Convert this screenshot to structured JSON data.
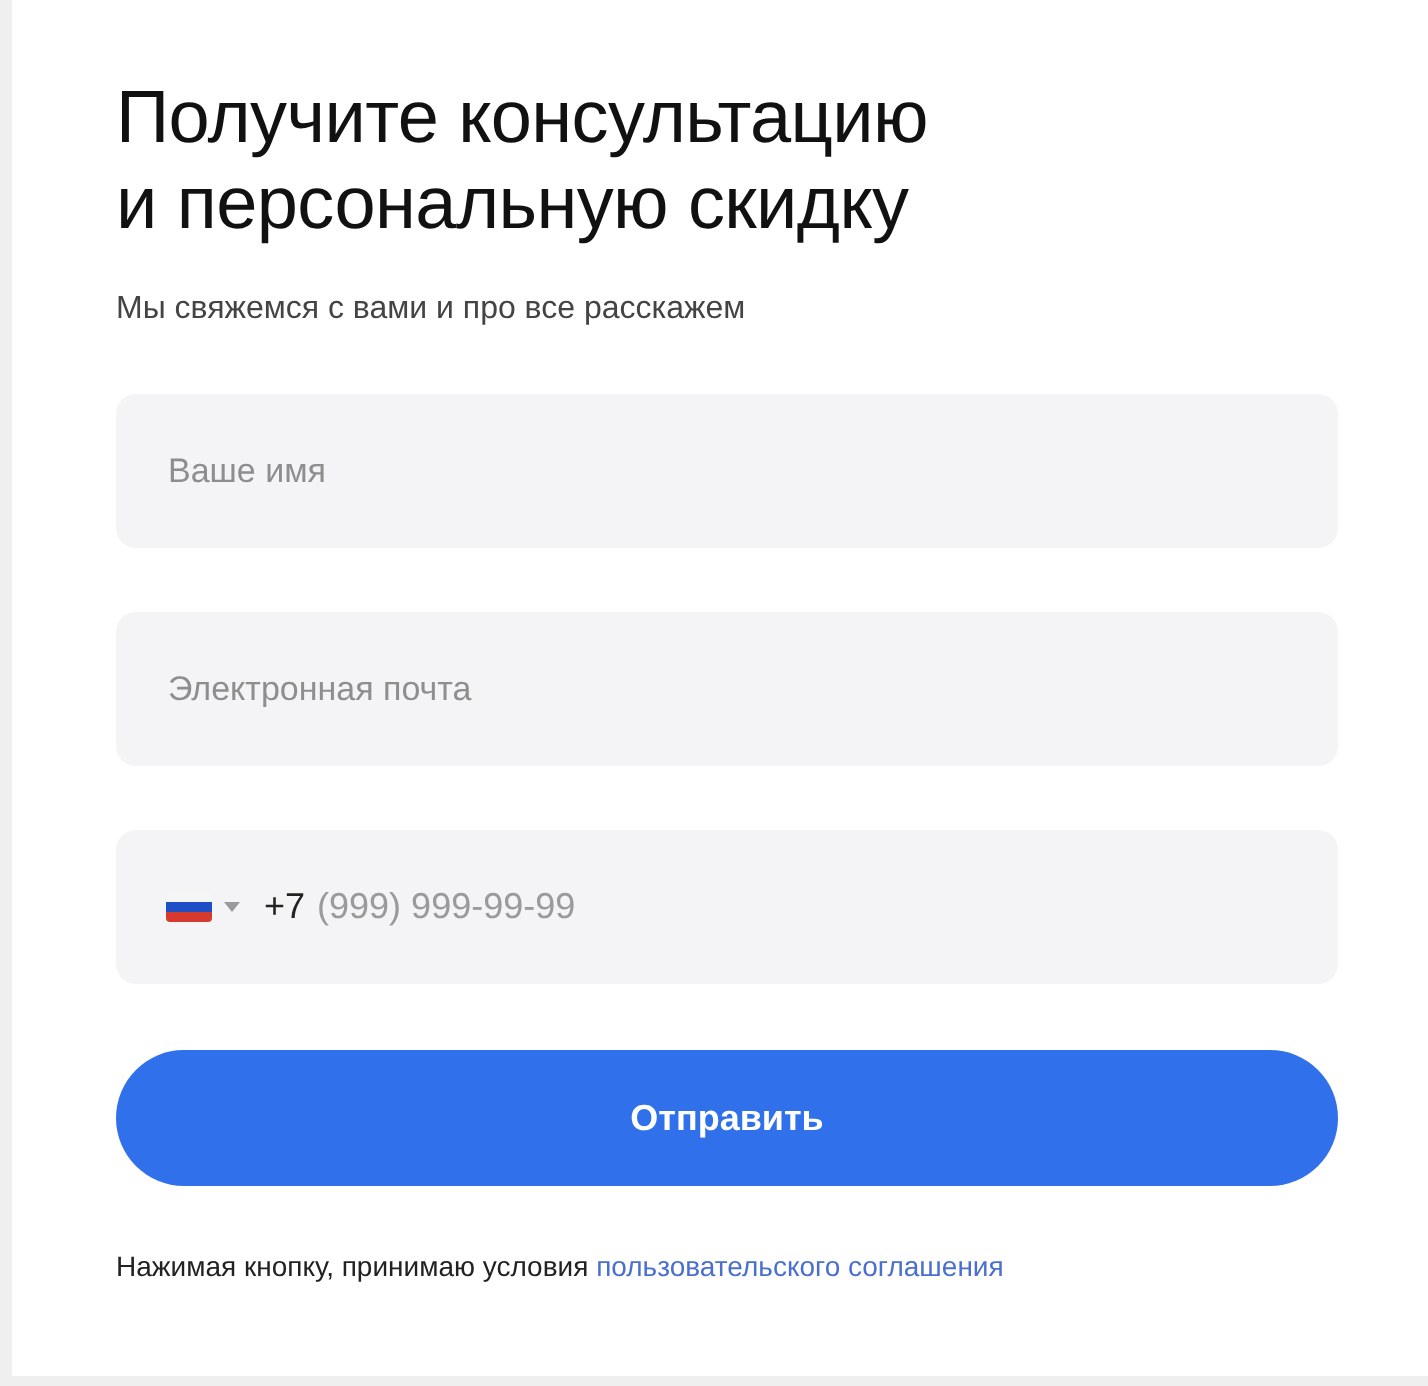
{
  "title_lines": [
    "Получите консультацию",
    "и персональную скидку"
  ],
  "subtitle": "Мы свяжемся с вами и про все расскажем",
  "fields": [
    {
      "kind": "text",
      "placeholder": "Ваше имя"
    },
    {
      "kind": "text",
      "placeholder": "Электронная почта"
    },
    {
      "kind": "phone",
      "prefix": "+7",
      "placeholder": "(999) 999-99-99"
    }
  ],
  "submit": "Отправить",
  "consent": {
    "text": "Нажимая кнопку, принимаю условия",
    "link": "пользовательского соглашения"
  }
}
